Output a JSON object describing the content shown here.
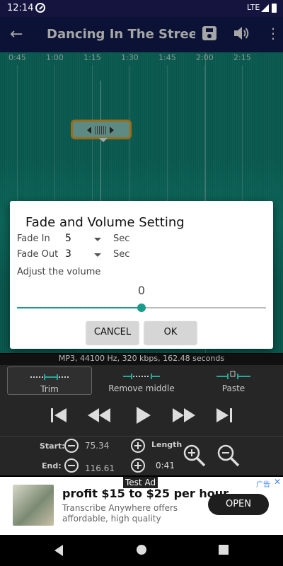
{
  "status_bar": {
    "time": "12:14",
    "network": "LTE"
  },
  "app_bar": {
    "title": "Dancing In The Street..."
  },
  "timeline": {
    "ticks": [
      {
        "label": "0:45",
        "pos": 0
      },
      {
        "label": "1:00",
        "pos": 1
      },
      {
        "label": "1:15",
        "pos": 2
      },
      {
        "label": "1:30",
        "pos": 3
      },
      {
        "label": "1:45",
        "pos": 4
      },
      {
        "label": "2:00",
        "pos": 5
      },
      {
        "label": "2:15",
        "pos": 6
      }
    ]
  },
  "dialog": {
    "title": "Fade and Volume Setting",
    "fade_in_label": "Fade In",
    "fade_in_value": "5",
    "fade_in_unit": "Sec",
    "fade_out_label": "Fade Out",
    "fade_out_value": "3",
    "fade_out_unit": "Sec",
    "volume_label": "Adjust the volume",
    "volume_value": "0",
    "volume_fraction": 0.5,
    "cancel_label": "CANCEL",
    "ok_label": "OK"
  },
  "file_info": "MP3, 44100 Hz, 320 kbps, 162.48 seconds",
  "modes": {
    "trim": "Trim",
    "remove_middle": "Remove middle",
    "paste": "Paste"
  },
  "range": {
    "start_label": "Start:",
    "start_value": "75.34",
    "end_label": "End:",
    "end_value": "116.61",
    "length_label": "Length",
    "length_value": "0:41"
  },
  "ad": {
    "badge": "Test Ad",
    "headline": "profit $15 to $25 per hour",
    "body": "Transcribe Anywhere offers affordable, high quality",
    "cta": "OPEN",
    "choice_label": "广告"
  },
  "colors": {
    "app_bar": "#121d52",
    "wave": "#0f8a7b",
    "accent": "#1a9a8a",
    "handle_border": "#f0a623"
  }
}
